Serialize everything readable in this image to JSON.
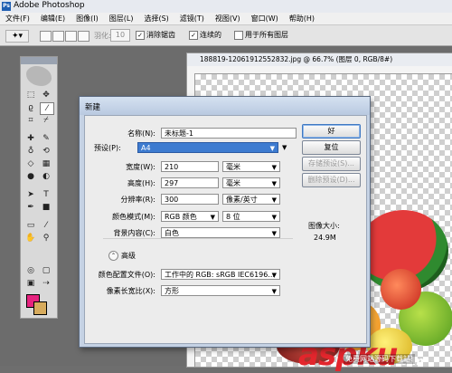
{
  "app": {
    "title": "Adobe Photoshop",
    "logo_text": "Ps"
  },
  "menu": [
    "文件(F)",
    "编辑(E)",
    "图像(I)",
    "图层(L)",
    "选择(S)",
    "滤镜(T)",
    "视图(V)",
    "窗口(W)",
    "帮助(H)"
  ],
  "options_bar": {
    "feather_label": "羽化:",
    "feather_value": "10",
    "antialias_label": "消除锯齿",
    "antialias_checked": true,
    "contiguous_label": "连续的",
    "contiguous_checked": true,
    "all_layers_label": "用于所有图层",
    "all_layers_checked": false
  },
  "toolbox": {
    "tools": [
      "marquee",
      "move",
      "lasso",
      "magic-wand",
      "crop",
      "slice",
      "heal",
      "brush",
      "clone",
      "history",
      "eraser",
      "gradient",
      "blur",
      "dodge",
      "pen",
      "type",
      "path-select",
      "shape",
      "notes",
      "eyedropper",
      "hand",
      "zoom"
    ],
    "foreground_color": "#e6237f",
    "background_color": "#d7ab5d"
  },
  "document": {
    "title": "188819-12061912552832.jpg @ 66.7% (图层 0, RGB/8#)"
  },
  "dialog": {
    "title": "新建",
    "name_label": "名称(N):",
    "name_value": "未标题-1",
    "preset_label": "预设(P):",
    "preset_value": "A4",
    "width_label": "宽度(W):",
    "width_value": "210",
    "width_unit": "毫米",
    "height_label": "高度(H):",
    "height_value": "297",
    "height_unit": "毫米",
    "resolution_label": "分辨率(R):",
    "resolution_value": "300",
    "resolution_unit": "像素/英寸",
    "color_mode_label": "颜色模式(M):",
    "color_mode_value": "RGB 颜色",
    "bit_depth_value": "8 位",
    "bg_contents_label": "背景内容(C):",
    "bg_contents_value": "白色",
    "advanced_label": "高级",
    "color_profile_label": "颜色配置文件(O):",
    "color_profile_value": "工作中的 RGB: sRGB IEC6196...",
    "pixel_aspect_label": "像素长宽比(X):",
    "pixel_aspect_value": "方形",
    "ok_label": "好",
    "reset_label": "复位",
    "save_preset_label": "存储预设(S)...",
    "delete_preset_label": "删除预设(D)...",
    "image_size_label": "图像大小:",
    "image_size_value": "24.9M"
  },
  "watermark": {
    "brand": "aspku",
    "brand_suffix": ".com",
    "tagline": "免费网站源码下载站!"
  }
}
